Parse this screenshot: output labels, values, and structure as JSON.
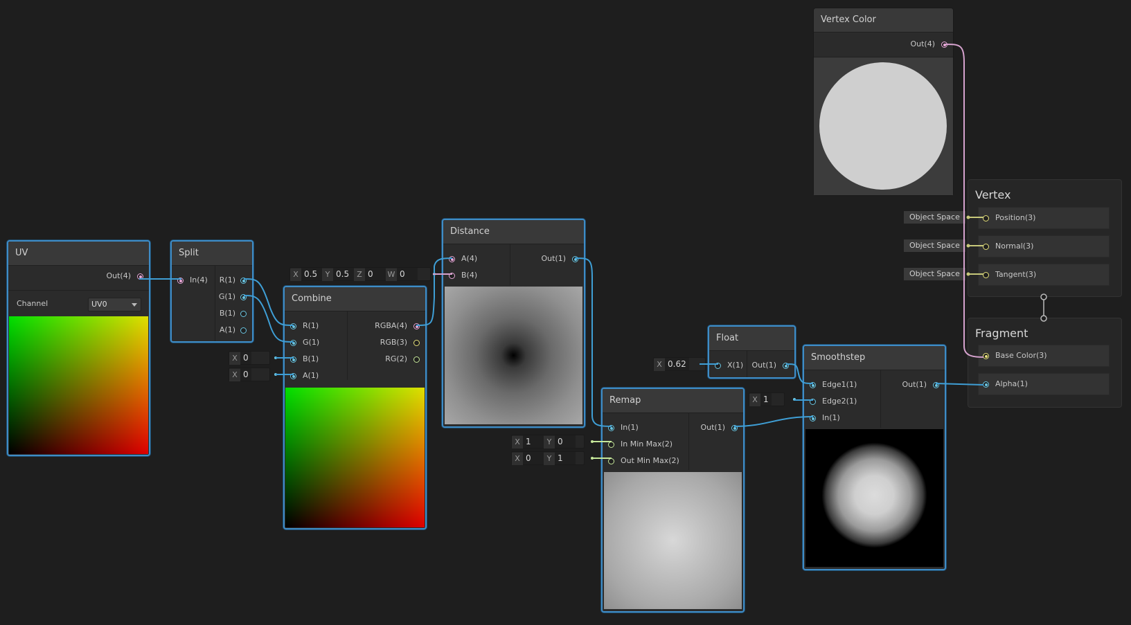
{
  "nodes": {
    "uv": {
      "title": "UV",
      "out_label": "Out(4)",
      "channel_label": "Channel",
      "channel_value": "UV0"
    },
    "split": {
      "title": "Split",
      "in_label": "In(4)",
      "outs": [
        "R(1)",
        "G(1)",
        "B(1)",
        "A(1)"
      ]
    },
    "combine": {
      "title": "Combine",
      "ins": [
        "R(1)",
        "G(1)",
        "B(1)",
        "A(1)"
      ],
      "outs": [
        "RGBA(4)",
        "RGB(3)",
        "RG(2)"
      ]
    },
    "distance": {
      "title": "Distance",
      "ins": [
        "A(4)",
        "B(4)"
      ],
      "out_label": "Out(1)"
    },
    "remap": {
      "title": "Remap",
      "ins": [
        "In(1)",
        "In Min Max(2)",
        "Out Min Max(2)"
      ],
      "out_label": "Out(1)"
    },
    "float": {
      "title": "Float",
      "in_label": "X(1)",
      "out_label": "Out(1)"
    },
    "smoothstep": {
      "title": "Smoothstep",
      "ins": [
        "Edge1(1)",
        "Edge2(1)",
        "In(1)"
      ],
      "out_label": "Out(1)"
    },
    "vertex_color": {
      "title": "Vertex Color",
      "out_label": "Out(4)"
    }
  },
  "inputs": {
    "distance_b": {
      "x_label": "X",
      "x": "0.5",
      "y_label": "Y",
      "y": "0.5",
      "z_label": "Z",
      "z": "0",
      "w_label": "W",
      "w": "0"
    },
    "combine_b": {
      "x_label": "X",
      "x": "0"
    },
    "combine_a": {
      "x_label": "X",
      "x": "0"
    },
    "remap_inminmax": {
      "x_label": "X",
      "x": "1",
      "y_label": "Y",
      "y": "0"
    },
    "remap_outminmax": {
      "x_label": "X",
      "x": "0",
      "y_label": "Y",
      "y": "1"
    },
    "float_x": {
      "x_label": "X",
      "x": "0.62"
    },
    "smoothstep_edge2": {
      "x_label": "X",
      "x": "1"
    }
  },
  "master": {
    "vertex": {
      "title": "Vertex",
      "slots": [
        "Position(3)",
        "Normal(3)",
        "Tangent(3)"
      ],
      "space_label": "Object Space"
    },
    "fragment": {
      "title": "Fragment",
      "slots": [
        "Base Color(3)",
        "Alpha(1)"
      ]
    }
  },
  "colors": {
    "wire_float": "#3f9fd6",
    "wire_vec4": "#d7a3cf",
    "wire_vec3": "#c8c97a",
    "selection": "#3f8cc6",
    "canvas": "#1e1e1e"
  }
}
